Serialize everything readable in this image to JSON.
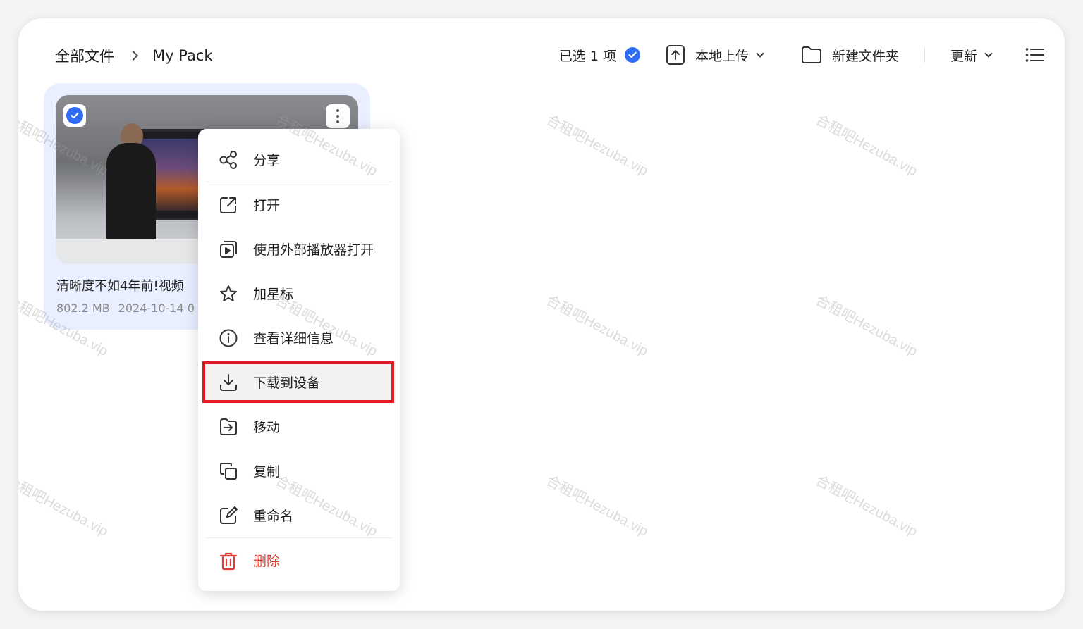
{
  "breadcrumb": {
    "root": "全部文件",
    "current": "My Pack"
  },
  "toolbar": {
    "selected": "已选 1 项",
    "upload": "本地上传",
    "new_folder": "新建文件夹",
    "sort": "更新"
  },
  "file": {
    "name": "清晰度不如4年前!视频",
    "size": "802.2 MB",
    "date": "2024-10-14 0"
  },
  "menu": {
    "items": [
      {
        "label": "分享",
        "icon": "share-icon"
      },
      {
        "label": "打开",
        "icon": "open-external-icon"
      },
      {
        "label": "使用外部播放器打开",
        "icon": "player-icon"
      },
      {
        "label": "加星标",
        "icon": "star-icon"
      },
      {
        "label": "查看详细信息",
        "icon": "info-icon"
      },
      {
        "label": "下载到设备",
        "icon": "download-icon"
      },
      {
        "label": "移动",
        "icon": "move-icon"
      },
      {
        "label": "复制",
        "icon": "copy-icon"
      },
      {
        "label": "重命名",
        "icon": "rename-icon"
      },
      {
        "label": "删除",
        "icon": "trash-icon"
      }
    ]
  },
  "watermark": "合租吧Hezuba.vip",
  "colors": {
    "accent": "#2f6df6",
    "danger": "#e53935",
    "highlight_border": "#e41b23",
    "card_bg": "#e9efff"
  }
}
